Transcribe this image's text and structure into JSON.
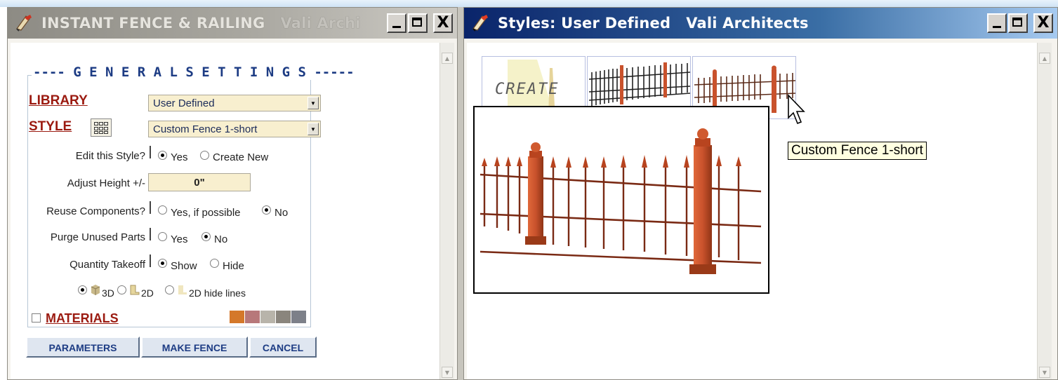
{
  "left_window": {
    "title": "INSTANT FENCE & RAILING",
    "org": "Vali Archi",
    "section_heading": "---- G E N E R A L   S E T T I N G S -----",
    "library": {
      "label": "LIBRARY",
      "value": "User Defined"
    },
    "style": {
      "label": "STYLE",
      "value": "Custom Fence 1-short",
      "icon": "grid-icon"
    },
    "edit_style": {
      "label": "Edit this Style?",
      "options": [
        "Yes",
        "Create New"
      ],
      "selected": "Yes"
    },
    "adjust_height": {
      "label": "Adjust Height +/-",
      "value": "0\""
    },
    "reuse_components": {
      "label": "Reuse Components?",
      "options": [
        "Yes, if possible",
        "No"
      ],
      "selected": "No"
    },
    "purge_unused": {
      "label": "Purge Unused Parts",
      "options": [
        "Yes",
        "No"
      ],
      "selected": "No"
    },
    "quantity_takeoff": {
      "label": "Quantity Takeoff",
      "options": [
        "Show",
        "Hide"
      ],
      "selected": "Show"
    },
    "view_mode": {
      "options": [
        "3D",
        "2D",
        "2D hide lines"
      ],
      "selected": "3D"
    },
    "materials": {
      "label": "MATERIALS",
      "checked": false,
      "swatches": [
        "#d4782a",
        "#b7787a",
        "#b8b4aa",
        "#8a857d",
        "#7d8089"
      ]
    },
    "buttons": {
      "parameters": "PARAMETERS",
      "make_fence": "MAKE FENCE",
      "cancel": "CANCEL"
    }
  },
  "right_window": {
    "title": "Styles: User Defined",
    "org": "Vali Architects",
    "thumbnails": [
      {
        "label": "CREATE"
      },
      {
        "label": ""
      },
      {
        "label": ""
      }
    ],
    "tooltip": "Custom Fence 1-short"
  },
  "window_buttons": {
    "close": "X"
  },
  "colors": {
    "fence": "#c9522c",
    "fence_dark": "#8f3416",
    "titlebar_active": "#0a246a",
    "label_red": "#9b1a10",
    "heading_blue": "#1d3c84"
  }
}
